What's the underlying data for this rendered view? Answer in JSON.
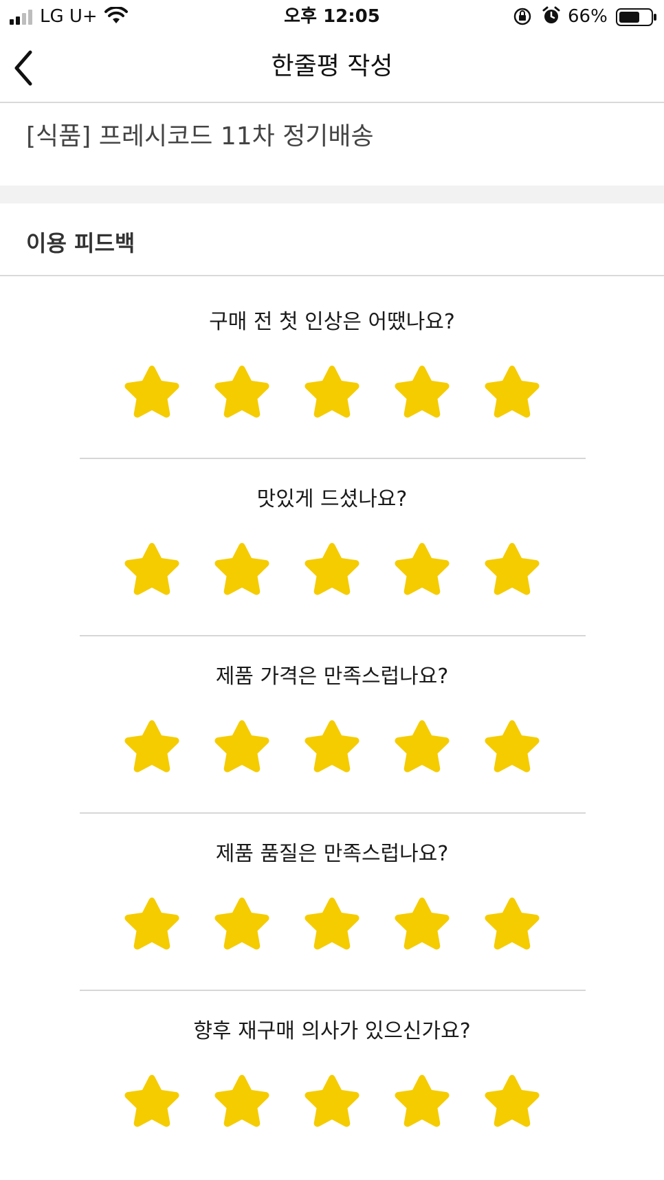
{
  "status_bar": {
    "carrier": "LG U+",
    "time": "오후 12:05",
    "battery_percent": "66%",
    "battery_level": 0.66
  },
  "header": {
    "title": "한줄평 작성",
    "back_icon": "chevron-left-icon"
  },
  "product": {
    "name": "[식품] 프레시코드 11차 정기배송"
  },
  "feedback": {
    "section_title": "이용 피드백",
    "star_color": "#F5CC00",
    "questions": [
      {
        "text": "구매 전 첫 인상은 어땠나요?",
        "rating": 5,
        "max": 5
      },
      {
        "text": "맛있게 드셨나요?",
        "rating": 5,
        "max": 5
      },
      {
        "text": "제품 가격은 만족스럽나요?",
        "rating": 5,
        "max": 5
      },
      {
        "text": "제품 품질은 만족스럽나요?",
        "rating": 5,
        "max": 5
      },
      {
        "text": "향후 재구매 의사가 있으신가요?",
        "rating": 5,
        "max": 5
      }
    ]
  }
}
